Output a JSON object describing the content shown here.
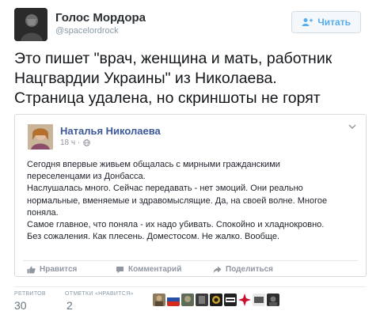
{
  "tweet": {
    "author_name": "Голос Мордора",
    "author_handle": "@spacelordrock",
    "follow_label": "Читать",
    "text_lines": [
      "Это пишет \"врач, женщина и мать, работник",
      "Нацгвардии Украины\" из Николаева.",
      "Страница удалена, но скриншоты не горят"
    ]
  },
  "fb_post": {
    "author_name": "Наталья Николаева",
    "time": "18 ч ·",
    "body_lines": [
      "Сегодня впервые живьем общалась с мирными гражданскими",
      "переселенцами из Донбасса.",
      "Наслушалась много. Сейчас передавать - нет эмоций. Они реально",
      "нормальные, вменяемые и здравомыслящие. Да, на своей волне. Многое",
      "поняла.",
      "Самое главное, что поняла - их надо убивать. Спокойно и хладнокровно.",
      "Без сожаления. Как плесень. Доместосом. Не жалко. Вообще."
    ],
    "actions": {
      "like": "Нравится",
      "comment": "Комментарий",
      "share": "Поделиться"
    }
  },
  "stats": {
    "retweets_label": "РЕТВИТОВ",
    "retweets_value": "30",
    "likes_label": "ОТМЕТКИ «НРАВИТСЯ»",
    "likes_value": "2"
  },
  "colors": {
    "twitter_blue": "#55acee",
    "facebook_blue": "#3b5998"
  }
}
